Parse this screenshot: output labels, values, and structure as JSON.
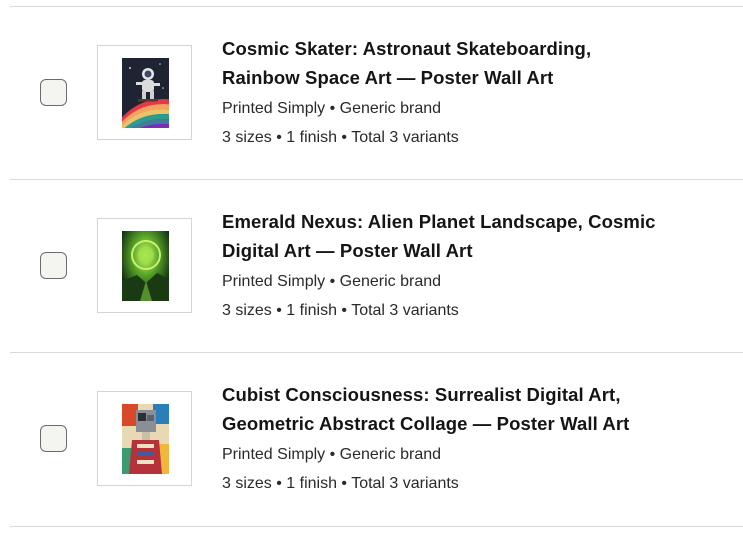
{
  "products": [
    {
      "title_line1": "Cosmic Skater: Astronaut Skateboarding,",
      "title_line2": "Rainbow Space Art — Poster Wall Art",
      "seller": "Printed Simply • Generic brand",
      "variants": "3 sizes • 1 finish • Total 3 variants",
      "thumbnail_icon": "astronaut-skateboard-poster"
    },
    {
      "title_line1": "Emerald Nexus: Alien Planet Landscape, Cosmic",
      "title_line2": "Digital Art — Poster Wall Art",
      "seller": "Printed Simply • Generic brand",
      "variants": "3 sizes • 1 finish • Total 3 variants",
      "thumbnail_icon": "green-planet-poster"
    },
    {
      "title_line1": "Cubist Consciousness: Surrealist Digital Art,",
      "title_line2": "Geometric Abstract Collage — Poster Wall Art",
      "seller": "Printed Simply • Generic brand",
      "variants": "3 sizes • 1 finish • Total 3 variants",
      "thumbnail_icon": "cubist-collage-poster"
    }
  ],
  "colors": {
    "divider": "#d9d9d9",
    "checkbox_border": "#6b6b6b",
    "title_text": "#151515",
    "meta_text": "#2a2a2a"
  }
}
